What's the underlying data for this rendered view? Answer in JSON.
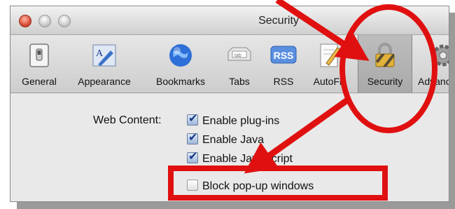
{
  "window": {
    "title": "Security"
  },
  "toolbar": {
    "items": [
      {
        "label": "General",
        "icon": "general-switch-icon"
      },
      {
        "label": "Appearance",
        "icon": "appearance-icon"
      },
      {
        "label": "Bookmarks",
        "icon": "globe-icon"
      },
      {
        "label": "Tabs",
        "icon": "tabs-icon"
      },
      {
        "label": "RSS",
        "icon": "rss-icon",
        "icon_text": "RSS"
      },
      {
        "label": "AutoFill",
        "icon": "autofill-icon"
      },
      {
        "label": "Security",
        "icon": "lock-icon",
        "active": true
      },
      {
        "label": "Advanced",
        "icon": "gear-icon"
      }
    ]
  },
  "web_content": {
    "label": "Web Content:",
    "options": [
      {
        "label": "Enable plug-ins",
        "checked": true
      },
      {
        "label": "Enable Java",
        "checked": true
      },
      {
        "label": "Enable JavaScript",
        "checked": true
      },
      {
        "label": "Block pop-up windows",
        "checked": false
      }
    ]
  },
  "annotation_colors": {
    "highlight": "#e01010"
  }
}
